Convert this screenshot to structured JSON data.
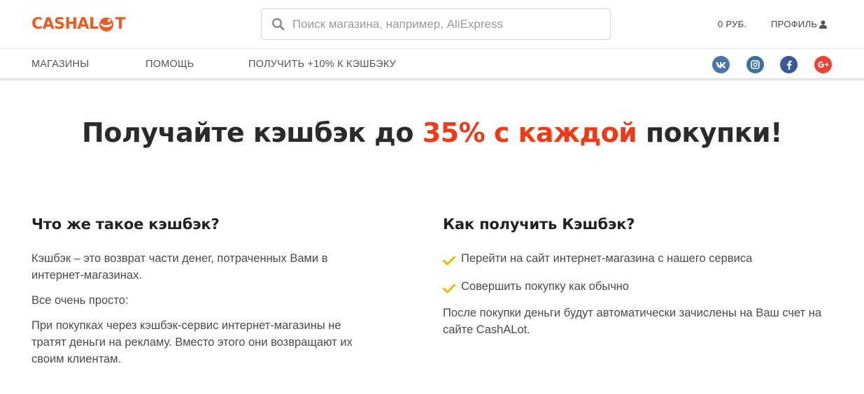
{
  "header": {
    "logo": {
      "part1": "CASHAL",
      "part2": "T"
    },
    "search": {
      "placeholder": "Поиск магазина, например, AliExpress",
      "value": ""
    },
    "balance": "0 РУБ.",
    "profile_label": "ПРОФИЛЬ"
  },
  "nav": {
    "items": [
      {
        "label": "МАГАЗИНЫ"
      },
      {
        "label": "ПОМОЩЬ"
      },
      {
        "label": "ПОЛУЧИТЬ +10% К КЭШБЭКУ"
      }
    ],
    "social": [
      {
        "name": "vk-icon",
        "color": "#4a76a8"
      },
      {
        "name": "instagram-icon",
        "color": "#3f729b"
      },
      {
        "name": "facebook-icon",
        "color": "#3b5998"
      },
      {
        "name": "google-plus-icon",
        "color": "#ea4335"
      }
    ]
  },
  "hero": {
    "before": "Получайте кэшбэк до ",
    "accent": "35% с каждой",
    "after": " покупки!"
  },
  "left": {
    "title": "Что же такое кэшбэк?",
    "paragraphs": [
      "Кэшбэк – это возврат части денег, потраченных Вами в интернет-магазинах.",
      "Все очень просто:",
      "При покупках через кэшбэк-сервис интернет-магазины не тратят деньги на рекламу. Вместо этого они возвращают их своим клиентам."
    ]
  },
  "right": {
    "title": "Как получить Кэшбэк?",
    "steps": [
      "Перейти на сайт интернет-магазина с нашего сервиса",
      "Совершить покупку как обычно"
    ],
    "note": "После покупки деньги будут автоматически зачислены на Ваш счет на сайте CashALot."
  },
  "colors": {
    "brand": "#f05a22",
    "accent": "#ee3a17",
    "check": "#f4b400"
  }
}
